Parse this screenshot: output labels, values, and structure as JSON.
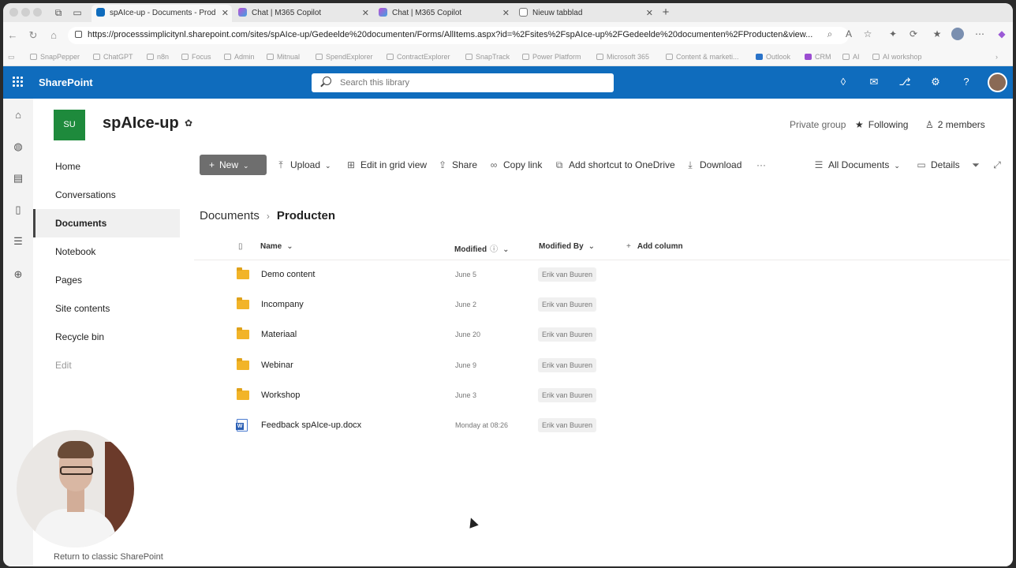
{
  "browser": {
    "tabs": [
      {
        "title": "spAIce-up - Documents - Prod",
        "active": true,
        "favicon_color": "#0f6cbd"
      },
      {
        "title": "Chat | M365 Copilot",
        "active": false,
        "favicon_color": "#c04fd6"
      },
      {
        "title": "Chat | M365 Copilot",
        "active": false,
        "favicon_color": "#c04fd6"
      },
      {
        "title": "Nieuw tabblad",
        "active": false,
        "favicon_color": "#777777"
      }
    ],
    "new_tab_icon": "plus-icon",
    "url": "https://processsimplicitynl.sharepoint.com/sites/spAIce-up/Gedeelde%20documenten/Forms/AllItems.aspx?id=%2Fsites%2FspAIce-up%2FGedeelde%20documenten%2FProducten&view...",
    "bookmarks": [
      "SnapPepper",
      "ChatGPT",
      "n8n",
      "Focus",
      "Admin",
      "Mitnual",
      "SpendExplorer",
      "ContractExplorer",
      "SnapTrack",
      "Power Platform",
      "Microsoft 365",
      "Content & marketi...",
      "Outlook",
      "CRM",
      "AI",
      "AI workshop"
    ]
  },
  "suite": {
    "app_name": "SharePoint",
    "search_placeholder": "Search this library",
    "brand_color": "#0f6cbd"
  },
  "site": {
    "logo_initials": "SU",
    "name": "spAIce-up",
    "privacy": "Private group",
    "following": "Following",
    "members": "2 members"
  },
  "nav": {
    "items": [
      "Home",
      "Conversations",
      "Documents",
      "Notebook",
      "Pages",
      "Site contents",
      "Recycle bin",
      "Edit"
    ],
    "selected": "Documents",
    "footer": "Return to classic SharePoint"
  },
  "commands": {
    "new": "New",
    "upload": "Upload",
    "grid": "Edit in grid view",
    "share": "Share",
    "copy_link": "Copy link",
    "shortcut": "Add shortcut to OneDrive",
    "download": "Download",
    "more": "···",
    "view": "All Documents",
    "details": "Details"
  },
  "breadcrumb": {
    "root": "Documents",
    "current": "Producten"
  },
  "columns": {
    "name": "Name",
    "modified": "Modified",
    "modified_by": "Modified By",
    "add": "Add column"
  },
  "files": [
    {
      "name": "Demo content",
      "type": "folder",
      "modified": "June 5",
      "by": "Erik van Buuren"
    },
    {
      "name": "Incompany",
      "type": "folder",
      "modified": "June 2",
      "by": "Erik van Buuren"
    },
    {
      "name": "Materiaal",
      "type": "folder",
      "modified": "June 20",
      "by": "Erik van Buuren"
    },
    {
      "name": "Webinar",
      "type": "folder",
      "modified": "June 9",
      "by": "Erik van Buuren"
    },
    {
      "name": "Workshop",
      "type": "folder",
      "modified": "June 3",
      "by": "Erik van Buuren"
    },
    {
      "name": "Feedback spAIce-up.docx",
      "type": "docx",
      "modified": "Monday at 08:26",
      "by": "Erik van Buuren"
    }
  ]
}
